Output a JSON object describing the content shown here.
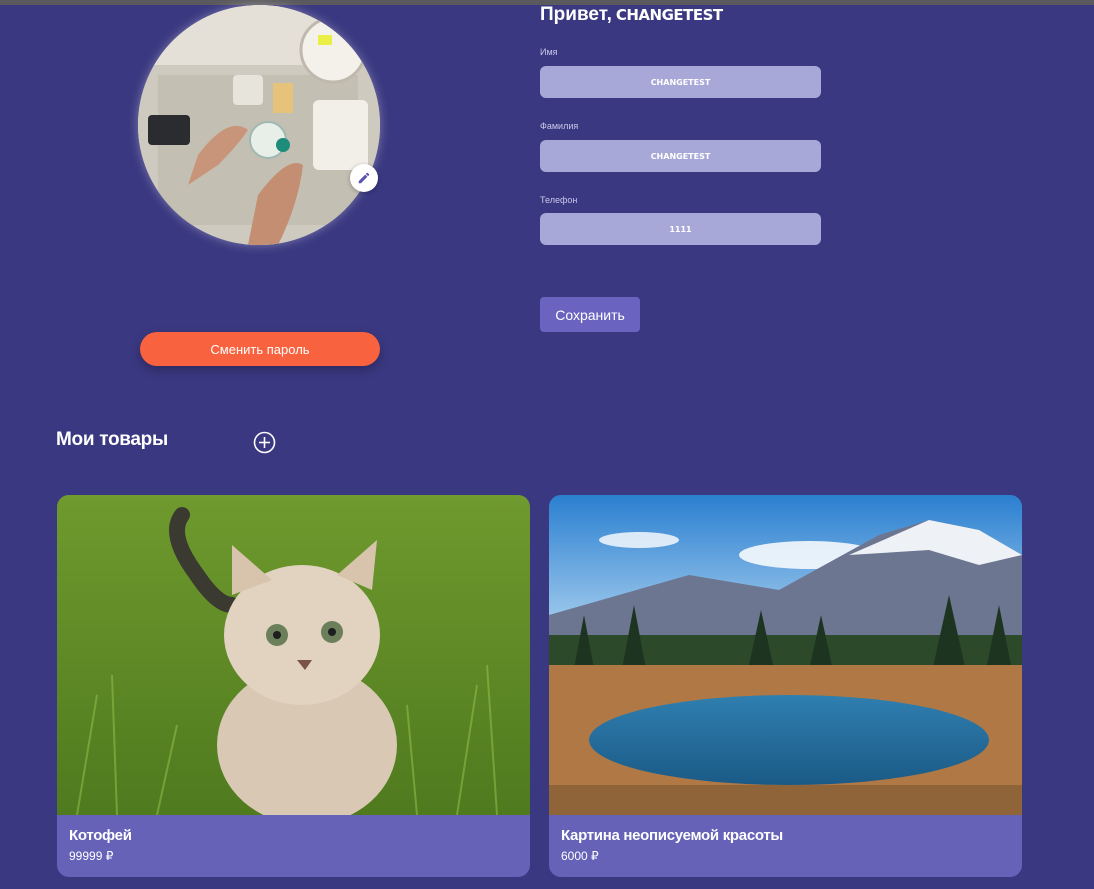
{
  "profile": {
    "greeting": "Привет,",
    "username": "CHANGETEST",
    "change_password_label": "Сменить пароль",
    "fields": [
      {
        "label": "Имя",
        "value": "CHANGETEST"
      },
      {
        "label": "Фамилия",
        "value": "CHANGETEST"
      },
      {
        "label": "Телефон",
        "value": "1111"
      }
    ],
    "save_label": "Сохранить"
  },
  "products_section": {
    "title": "Мои товары",
    "items": [
      {
        "title": "Котофей",
        "price": "99999 ₽",
        "image": "kitten-in-grass"
      },
      {
        "title": "Картина неописуемой красоты",
        "price": "6000 ₽",
        "image": "mountain-lake-landscape"
      }
    ]
  },
  "icons": {
    "edit": "pencil-icon",
    "add": "plus-circle-icon"
  },
  "colors": {
    "background": "#3a3880",
    "input_bg": "#a8a8d8",
    "accent_orange": "#f8623e",
    "button_purple": "#6a64c0",
    "card_bg": "#6662b8"
  }
}
